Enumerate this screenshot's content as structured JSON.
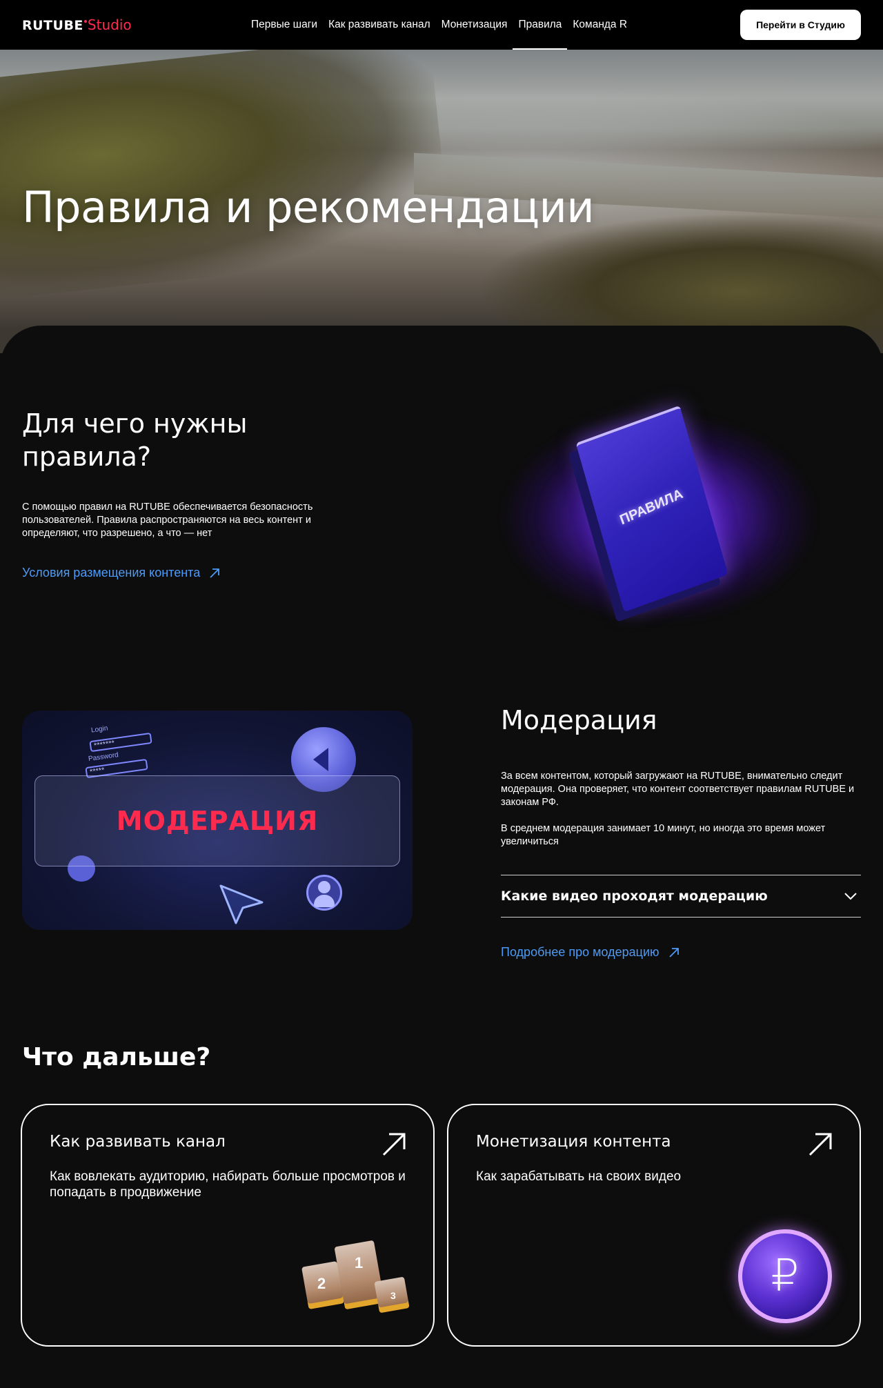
{
  "header": {
    "logo_main": "RUTUBE",
    "logo_sub": "Studio",
    "nav": [
      {
        "label": "Первые шаги"
      },
      {
        "label": "Как развивать канал"
      },
      {
        "label": "Монетизация"
      },
      {
        "label": "Правила",
        "active": true
      },
      {
        "label": "Команда R"
      }
    ],
    "cta_label": "Перейти в Студию"
  },
  "hero": {
    "title": "Правила и рекомендации"
  },
  "rules_section": {
    "title": "Для чего нужны правила?",
    "text": "С помощью правил на RUTUBE обеспечивается безопасность пользователей. Правила распространяются на весь контент и определяют, что разрешено, а что — нет",
    "link_label": "Условия размещения контента",
    "book_label": "ПРАВИЛА"
  },
  "moderation_section": {
    "image_text": "МОДЕРАЦИЯ",
    "image_login_label": "Login",
    "image_password_label": "Password",
    "image_password_mask": "*******",
    "image_password_mask_short": "*****",
    "title": "Модерация",
    "paragraphs": [
      "За всем контентом, который загружают на RUTUBE, внимательно следит модерация. Она проверяет, что контент соответствует правилам RUTUBE и законам РФ.",
      "В среднем модерация занимает 10 минут, но иногда это время может увеличиться"
    ],
    "accordion_label": "Какие видео проходят модерацию",
    "link_label": "Подробнее про модерацию"
  },
  "next_section": {
    "title": "Что дальше?",
    "cards": [
      {
        "title": "Как развивать канал",
        "text": "Как вовлекать аудиторию, набирать больше просмотров и попадать в продвижение",
        "podium_numbers": [
          "2",
          "1",
          "3"
        ]
      },
      {
        "title": "Монетизация контента",
        "text": "Как зарабатывать на своих видео",
        "coin_symbol": "₽"
      }
    ]
  },
  "colors": {
    "background": "#0d0d0d",
    "accent_red": "#ff2b4f",
    "link_blue": "#4d9bf7",
    "violet": "#6a3cff"
  }
}
